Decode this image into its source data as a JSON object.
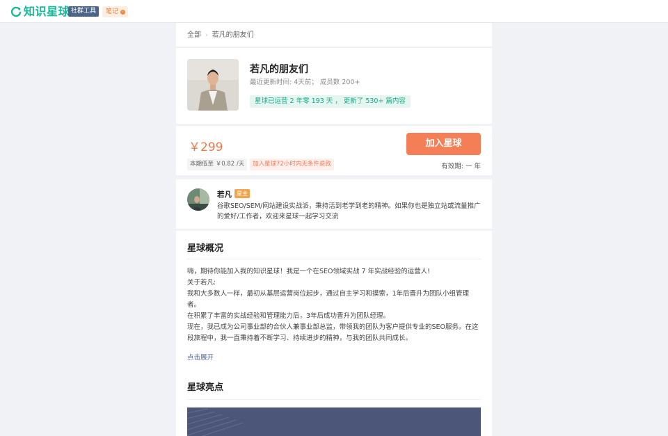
{
  "topbar": {
    "logo_text": "知识星球",
    "tool_badge": "社群工具",
    "note_label": "笔记"
  },
  "breadcrumb": {
    "root": "全部",
    "current": "若凡的朋友们"
  },
  "group": {
    "name": "若凡的朋友们",
    "last_update": "最近更新时间: 4天前；  成员数 200+",
    "runtime": "星球已运营 2 年零 193 天 ， 更新了 530+ 篇内容"
  },
  "pricing": {
    "price": "￥299",
    "join_label": "加入星球",
    "daily": "本期低至 ￥0.82 /天",
    "refund": "加入星球72小时内无条件退款",
    "validity": "有效期: 一 年"
  },
  "owner": {
    "name": "若凡",
    "tag": "星主",
    "intro": "谷歌SEO/SEM/网站建设实战派，秉持活到老学到老的精神。如果你也是独立站或流量推广的爱好/工作者，欢迎来星球一起学习交流"
  },
  "overview": {
    "title": "星球概况",
    "lines": [
      " 嗨，期待你能加入我的知识星球！我是一个在SEO领域实战 7 年实战经验的运营人!",
      "关于若凡:",
      "我和大多数人一样，最初从基层运营岗位起步，通过自主学习和摸索，1年后晋升为团队小组管理者。",
      "在积累了丰富的实战经验和管理能力后，3年后成功晋升为团队经理。",
      "现在，我已成为公司事业部的合伙人兼事业部总监，带领我的团队为客户提供专业的SEO服务。在这段旅程中，我一直秉持着不断学习、持续进步的精神，与我的团队共同成长。"
    ],
    "expand_label": "点击展开"
  },
  "highlights": {
    "title": "星球亮点"
  },
  "colors": {
    "brand": "#16b998",
    "accent": "#f47e55",
    "link": "#4a6a9b"
  }
}
